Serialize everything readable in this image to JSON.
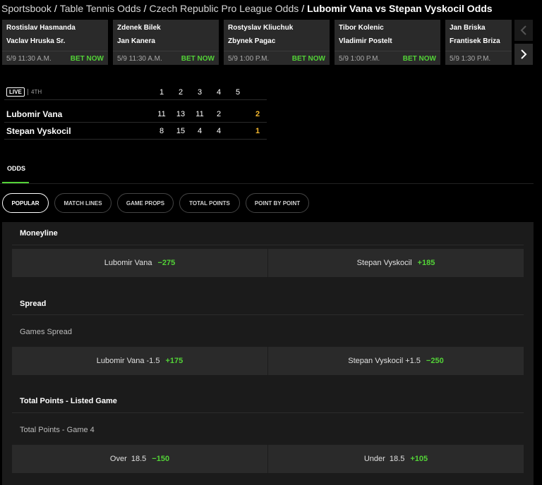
{
  "breadcrumb": [
    {
      "label": "Sportsbook"
    },
    {
      "label": "Table Tennis Odds"
    },
    {
      "label": "Czech Republic Pro League Odds"
    },
    {
      "label": "Lubomir Vana vs Stepan Vyskocil Odds"
    }
  ],
  "ticker": {
    "cards": [
      {
        "p1": "Rostislav Hasmanda",
        "p2": "Vaclav Hruska Sr.",
        "time": "5/9 11:30 A.M.",
        "bet": "BET NOW"
      },
      {
        "p1": "Zdenek Bilek",
        "p2": "Jan Kanera",
        "time": "5/9 11:30 A.M.",
        "bet": "BET NOW"
      },
      {
        "p1": "Rostyslav Kliuchuk",
        "p2": "Zbynek Pagac",
        "time": "5/9 1:00 P.M.",
        "bet": "BET NOW"
      },
      {
        "p1": "Tibor Kolenic",
        "p2": "Vladimir Postelt",
        "time": "5/9 1:00 P.M.",
        "bet": "BET NOW"
      },
      {
        "p1": "Jan Briska",
        "p2": "Frantisek Briza",
        "time": "5/9 1:30 P.M.",
        "bet": ""
      }
    ],
    "prev_icon": "chevron-left-icon",
    "next_icon": "chevron-right-icon"
  },
  "scoreboard": {
    "live_label": "LIVE",
    "period": "4TH",
    "columns": [
      "1",
      "2",
      "3",
      "4",
      "5"
    ],
    "rows": [
      {
        "name": "Lubomir Vana",
        "games": [
          "11",
          "13",
          "11",
          "2"
        ],
        "total": "2"
      },
      {
        "name": "Stepan Vyskocil",
        "games": [
          "8",
          "15",
          "4",
          "4"
        ],
        "total": "1"
      }
    ]
  },
  "odds_tab": "ODDS",
  "filters": [
    {
      "label": "POPULAR",
      "active": true
    },
    {
      "label": "MATCH LINES",
      "active": false
    },
    {
      "label": "GAME PROPS",
      "active": false
    },
    {
      "label": "TOTAL POINTS",
      "active": false
    },
    {
      "label": "POINT BY POINT",
      "active": false
    }
  ],
  "markets": {
    "moneyline": {
      "title": "Moneyline",
      "options": [
        {
          "label": "Lubomir Vana",
          "price": "−275"
        },
        {
          "label": "Stepan Vyskocil",
          "price": "+185"
        }
      ]
    },
    "spread": {
      "title": "Spread",
      "sub": "Games Spread",
      "options": [
        {
          "label": "Lubomir Vana -1.5",
          "price": "+175"
        },
        {
          "label": "Stepan Vyskocil +1.5",
          "price": "−250"
        }
      ]
    },
    "total": {
      "title": "Total Points - Listed Game",
      "sub": "Total Points - Game 4",
      "options": [
        {
          "label": "Over  18.5",
          "price": "−150"
        },
        {
          "label": "Under  18.5",
          "price": "+105"
        }
      ]
    }
  },
  "colors": {
    "accent": "#53d337",
    "score_total": "#f5b82e",
    "panel": "#1b1b1b",
    "button": "#2a2a2a"
  }
}
